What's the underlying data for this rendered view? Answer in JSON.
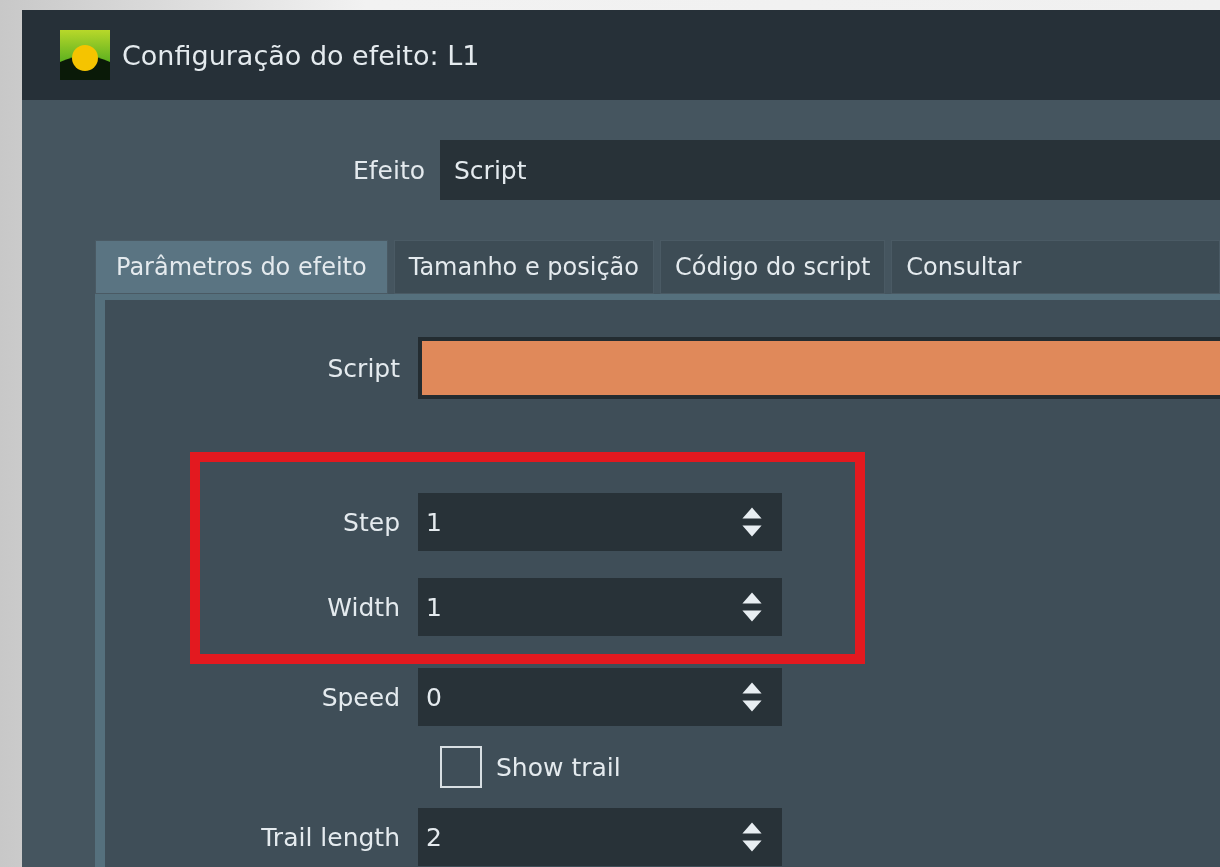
{
  "window": {
    "title": "Configuração do efeito: L1"
  },
  "effect": {
    "label": "Efeito",
    "value": "Script"
  },
  "tabs": [
    {
      "label": "Parâmetros do efeito",
      "selected": true
    },
    {
      "label": "Tamanho e posição",
      "selected": false
    },
    {
      "label": "Código do script",
      "selected": false
    },
    {
      "label": "Consultar",
      "selected": false
    }
  ],
  "script": {
    "label": "Script"
  },
  "highlighted_parameters": [
    {
      "kind": "spin",
      "label": "Step",
      "value": "1"
    },
    {
      "kind": "spin",
      "label": "Width",
      "value": "1"
    }
  ],
  "parameters": [
    {
      "kind": "spin",
      "label": "Speed",
      "value": "0"
    },
    {
      "kind": "checkbox",
      "label": "Show trail",
      "checked": false
    },
    {
      "kind": "spin",
      "label": "Trail length",
      "value": "2"
    }
  ]
}
